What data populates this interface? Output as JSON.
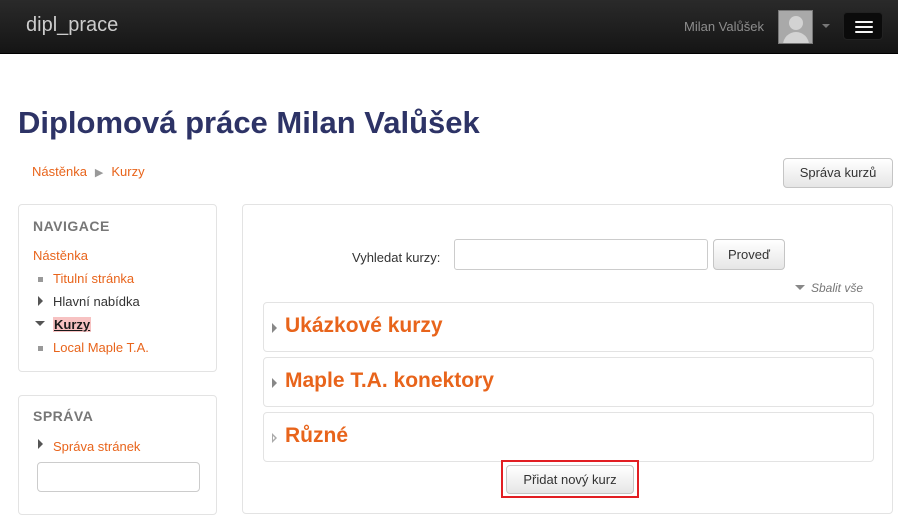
{
  "navbar": {
    "brand": "dipl_prace",
    "user_name": "Milan Valůšek",
    "user_icon": "avatar-placeholder-icon",
    "menu_icon": "hamburger-icon"
  },
  "page": {
    "title": "Diplomová práce Milan Valůšek",
    "breadcrumb": [
      "Nástěnka",
      "Kurzy"
    ],
    "manage_courses_button": "Správa kurzů"
  },
  "navigation_block": {
    "title": "NAVIGACE",
    "dashboard": "Nástěnka",
    "items": [
      {
        "label": "Titulní stránka",
        "marker": "bullet"
      },
      {
        "label": "Hlavní nabídka",
        "marker": "collapsed"
      },
      {
        "label": "Kurzy",
        "marker": "expanded",
        "active": true
      },
      {
        "label": "Local Maple T.A.",
        "marker": "bullet"
      }
    ]
  },
  "admin_block": {
    "title": "SPRÁVA",
    "items": [
      {
        "label": "Správa stránek"
      }
    ]
  },
  "main": {
    "search_label": "Vyhledat kurzy:",
    "search_value": "",
    "search_button": "Proveď",
    "collapse_all": "Sbalit vše",
    "categories": [
      {
        "name": "Ukázkové kurzy"
      },
      {
        "name": "Maple T.A. konektory"
      },
      {
        "name": "Různé"
      }
    ],
    "add_course_button": "Přidat nový kurz"
  },
  "colors": {
    "accent": "#e8641b",
    "title": "#2d3366",
    "navbar": "#1a1a1a",
    "highlight": "#e21e23"
  }
}
